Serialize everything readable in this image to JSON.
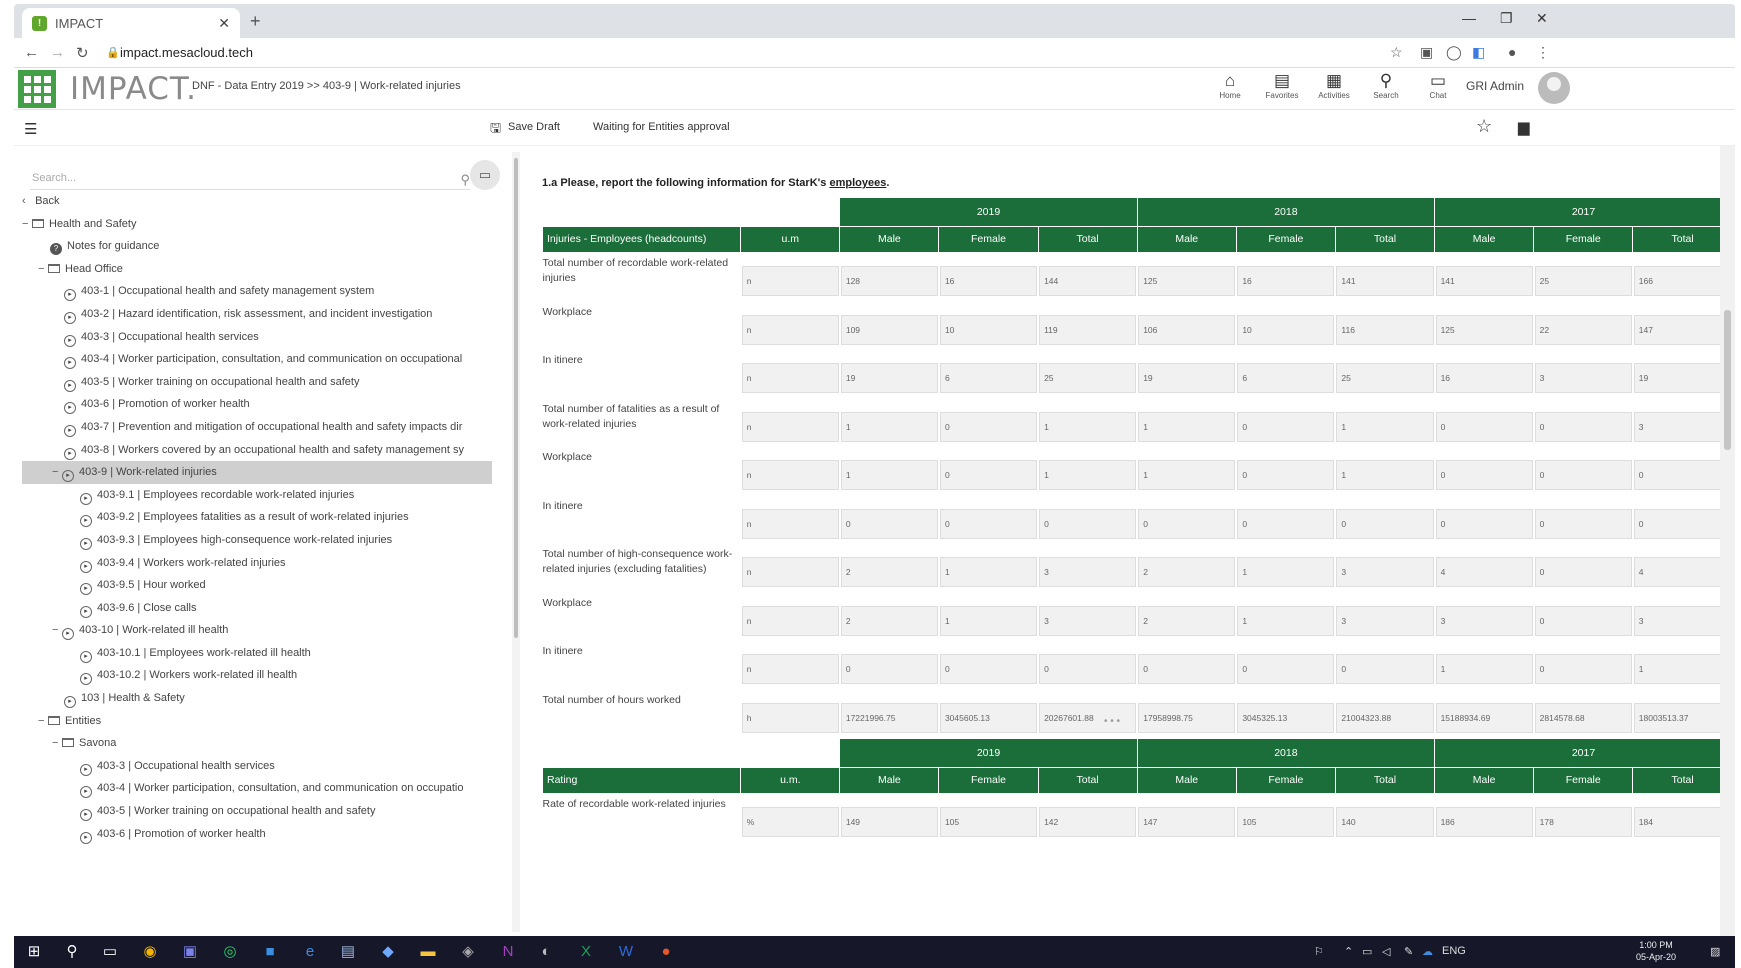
{
  "browser": {
    "tab_title": "IMPACT",
    "url": "impact.mesacloud.tech"
  },
  "app": {
    "logo": "IMPACT.",
    "breadcrumb": "DNF - Data Entry 2019 >> 403-9 | Work-related injuries",
    "nav": [
      {
        "label": "Home",
        "icon": "home-icon"
      },
      {
        "label": "Favorites",
        "icon": "favorites-icon"
      },
      {
        "label": "Activities",
        "icon": "activities-icon"
      },
      {
        "label": "Search",
        "icon": "search-icon"
      },
      {
        "label": "Chat",
        "icon": "chat-icon"
      }
    ],
    "user": "GRI Admin"
  },
  "toolbar": {
    "save_draft": "Save Draft",
    "status": "Waiting for Entities approval"
  },
  "sidebar": {
    "search_placeholder": "Search...",
    "back": "Back",
    "items": [
      {
        "label": "Health and Safety"
      },
      {
        "label": "Notes for guidance"
      },
      {
        "label": "Head Office"
      },
      {
        "label": "403-1 | Occupational health and safety management system"
      },
      {
        "label": "403-2 | Hazard identification, risk assessment, and incident investigation"
      },
      {
        "label": "403-3 | Occupational health services"
      },
      {
        "label": "403-4 | Worker participation, consultation, and communication on occupational"
      },
      {
        "label": "403-5 | Worker training on occupational health and safety"
      },
      {
        "label": "403-6 | Promotion of worker health"
      },
      {
        "label": "403-7 | Prevention and mitigation of occupational health and safety impacts dir"
      },
      {
        "label": "403-8 | Workers covered by an occupational health and safety management sy"
      },
      {
        "label": "403-9 | Work-related injuries"
      },
      {
        "label": "403-9.1 | Employees recordable work-related injuries"
      },
      {
        "label": "403-9.2 | Employees fatalities as a result of work-related injuries"
      },
      {
        "label": "403-9.3 | Employees high-consequence work-related injuries"
      },
      {
        "label": "403-9.4 | Workers work-related injuries"
      },
      {
        "label": "403-9.5 | Hour worked"
      },
      {
        "label": "403-9.6 | Close calls"
      },
      {
        "label": "403-10 | Work-related ill health"
      },
      {
        "label": "403-10.1 | Employees work-related ill health"
      },
      {
        "label": "403-10.2 | Workers work-related ill health"
      },
      {
        "label": "103 | Health & Safety"
      },
      {
        "label": "Entities"
      },
      {
        "label": "Savona"
      },
      {
        "label": "403-3 | Occupational health services"
      },
      {
        "label": "403-4 | Worker participation, consultation, and communication on occupatio"
      },
      {
        "label": "403-5 | Worker training on occupational health and safety"
      },
      {
        "label": "403-6 | Promotion of worker health"
      }
    ]
  },
  "main": {
    "question_prefix": "1.a Please, report the following information for StarK's",
    "question_link": "employees",
    "years": [
      "2019",
      "2018",
      "2017"
    ],
    "table1": {
      "title": "Injuries - Employees (headcounts)",
      "um_header": "u.m",
      "subheaders": [
        "Male",
        "Female",
        "Total"
      ],
      "rows": [
        {
          "label": "Total number of recordable work-related injuries",
          "um": "n",
          "values": [
            "128",
            "16",
            "144",
            "125",
            "16",
            "141",
            "141",
            "25",
            "166"
          ]
        },
        {
          "label": "Workplace",
          "um": "n",
          "values": [
            "109",
            "10",
            "119",
            "106",
            "10",
            "116",
            "125",
            "22",
            "147"
          ]
        },
        {
          "label": "In itinere",
          "um": "n",
          "values": [
            "19",
            "6",
            "25",
            "19",
            "6",
            "25",
            "16",
            "3",
            "19"
          ]
        },
        {
          "label": "Total number of fatalities as a result of work-related injuries",
          "um": "n",
          "values": [
            "1",
            "0",
            "1",
            "1",
            "0",
            "1",
            "0",
            "0",
            "3"
          ]
        },
        {
          "label": "Workplace",
          "um": "n",
          "values": [
            "1",
            "0",
            "1",
            "1",
            "0",
            "1",
            "0",
            "0",
            "0"
          ]
        },
        {
          "label": "In itinere",
          "um": "n",
          "values": [
            "0",
            "0",
            "0",
            "0",
            "0",
            "0",
            "0",
            "0",
            "0"
          ]
        },
        {
          "label": "Total number of high-consequence work-related injuries (excluding fatalities)",
          "um": "n",
          "values": [
            "2",
            "1",
            "3",
            "2",
            "1",
            "3",
            "4",
            "0",
            "4"
          ]
        },
        {
          "label": "Workplace",
          "um": "n",
          "values": [
            "2",
            "1",
            "3",
            "2",
            "1",
            "3",
            "3",
            "0",
            "3"
          ]
        },
        {
          "label": "In itinere",
          "um": "n",
          "values": [
            "0",
            "0",
            "0",
            "0",
            "0",
            "0",
            "1",
            "0",
            "1"
          ]
        },
        {
          "label": "Total number of hours worked",
          "um": "h",
          "values": [
            "17221996.75",
            "3045605.13",
            "20267601.88",
            "17958998.75",
            "3045325.13",
            "21004323.88",
            "15188934.69",
            "2814578.68",
            "18003513.37"
          ]
        }
      ]
    },
    "table2": {
      "title": "Rating",
      "um_header": "u.m.",
      "subheaders": [
        "Male",
        "Female",
        "Total"
      ],
      "rows": [
        {
          "label": "Rate of recordable work-related injuries",
          "um": "%",
          "values": [
            "149",
            "105",
            "142",
            "147",
            "105",
            "140",
            "186",
            "178",
            "184"
          ]
        }
      ]
    }
  },
  "taskbar": {
    "lang": "ENG",
    "time": "1:00 PM",
    "date": "05-Apr-20"
  }
}
